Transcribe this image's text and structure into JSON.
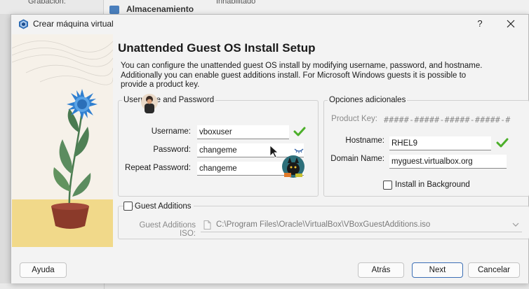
{
  "background": {
    "text_top_left": "Grabación:",
    "text_heading": "Almacenamiento",
    "text_right": "Inhabilitado"
  },
  "dialog": {
    "title": "Crear máquina virtual",
    "help_label": "?",
    "heading": "Unattended Guest OS Install Setup",
    "description": "You can configure the unattended guest OS install by modifying username, password, and hostname. Additionally you can enable guest additions install. For Microsoft Windows guests it is possible to provide a product key."
  },
  "user_group": {
    "title": "Username and Password",
    "username_label": "Username:",
    "username_value": "vboxuser",
    "password_label": "Password:",
    "password_value": "changeme",
    "repeat_label": "Repeat Password:",
    "repeat_value": "changeme"
  },
  "options_group": {
    "title": "Opciones adicionales",
    "product_key_label": "Product Key:",
    "product_key_value": "#####-#####-#####-#####-#",
    "hostname_label": "Hostname:",
    "hostname_value": "RHEL9",
    "domain_label": "Domain Name:",
    "domain_value": "myguest.virtualbox.org",
    "install_bg_label": "Install in Background",
    "install_bg_checked": false
  },
  "guest_additions": {
    "checkbox_label": "Guest Additions",
    "checked": false,
    "iso_label": "Guest Additions ISO:",
    "iso_path": "C:\\Program Files\\Oracle\\VirtualBox\\VBoxGuestAdditions.iso"
  },
  "footer": {
    "help_button": "Ayuda",
    "back_button": "Atrás",
    "next_button": "Next",
    "cancel_button": "Cancelar"
  },
  "colors": {
    "check_green": "#4caf2a",
    "primary_border": "#3c6fb5",
    "flower_blue": "#2f7fd0",
    "pot": "#8b3a2a",
    "ground": "#f1d98a"
  }
}
